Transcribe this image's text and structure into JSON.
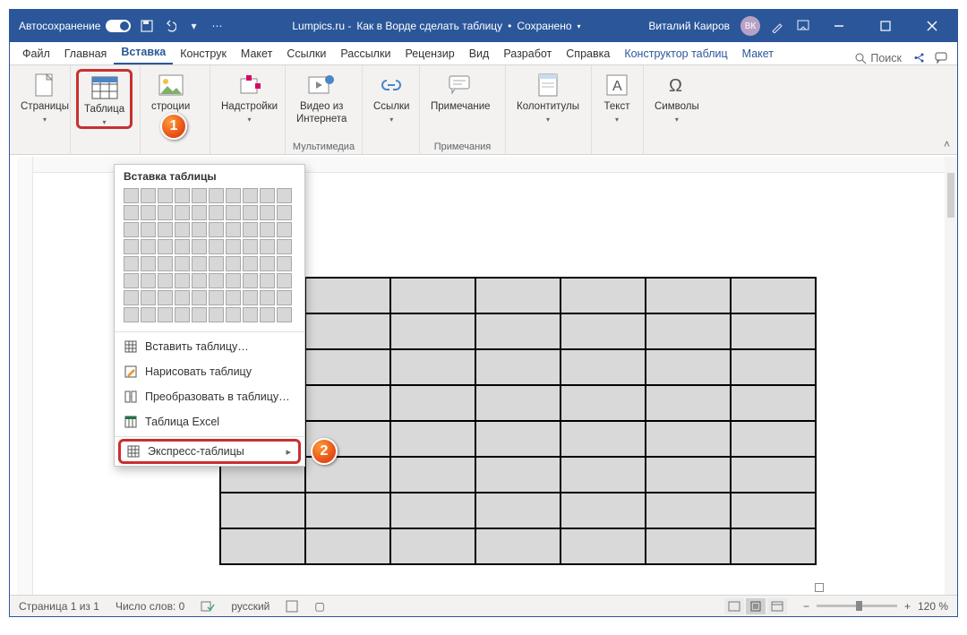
{
  "title": {
    "autosave": "Автосохранение",
    "doc_prefix": "Lumpics.ru - ",
    "doc_name": "Как в Ворде сделать таблицу",
    "saved": "Сохранено",
    "user": "Виталий Каиров",
    "user_initials": "ВК"
  },
  "tabs": {
    "items": [
      "Файл",
      "Главная",
      "Вставка",
      "Конструк",
      "Макет",
      "Ссылки",
      "Рассылки",
      "Рецензир",
      "Вид",
      "Разработ",
      "Справка",
      "Конструктор таблиц",
      "Макет"
    ],
    "active_index": 2,
    "context_indices": [
      11,
      12
    ],
    "search": "Поиск"
  },
  "ribbon": {
    "pages": {
      "label": "Страницы"
    },
    "table": {
      "label": "Таблица"
    },
    "illustrations": {
      "label": "стрoции"
    },
    "addins": {
      "btn": "Надстройки"
    },
    "media": {
      "btn": "Видео из\nИнтернета",
      "label": "Мультимедиа"
    },
    "links": {
      "btn": "Ссылки"
    },
    "comments": {
      "btn": "Примечание",
      "label": "Примечания"
    },
    "headerfooter": {
      "btn": "Колонтитулы"
    },
    "text": {
      "btn": "Текст"
    },
    "symbols": {
      "btn": "Символы"
    }
  },
  "dropdown": {
    "title": "Вставка таблицы",
    "items": [
      "Вставить таблицу…",
      "Нарисовать таблицу",
      "Преобразовать в таблицу…",
      "Таблица Excel",
      "Экспресс-таблицы"
    ]
  },
  "markers": {
    "one": "1",
    "two": "2"
  },
  "doc_table": {
    "rows": 8,
    "cols": 7
  },
  "status": {
    "page": "Страница 1 из 1",
    "words": "Число слов: 0",
    "lang": "русский",
    "zoom": "120 %"
  },
  "icons": {
    "save": "save-icon",
    "undo": "undo-icon",
    "redo": "redo-icon",
    "search": "search-icon",
    "share": "share-icon",
    "comments": "comments-icon"
  }
}
